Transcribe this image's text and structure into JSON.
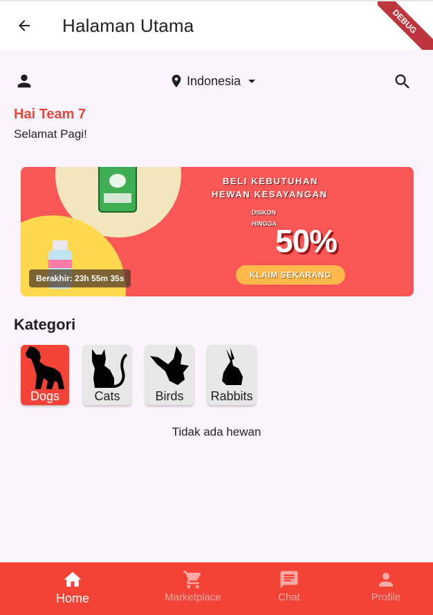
{
  "app_bar": {
    "title": "Halaman Utama"
  },
  "debug": {
    "label": "DEBUG"
  },
  "header": {
    "location": "Indonesia"
  },
  "greeting": {
    "title": "Hai Team 7",
    "subtitle": "Selamat Pagi!"
  },
  "banner": {
    "headline_1": "BELI KEBUTUHAN",
    "headline_2": "HEWAN KESAYANGAN",
    "discount_label": "DISKON HINGGA",
    "discount_value": "50%",
    "cta": "KLAIM SEKARANG",
    "timer": "Berakhir: 23h 55m 35s"
  },
  "categories": {
    "title": "Kategori",
    "items": [
      {
        "label": "Dogs",
        "selected": true
      },
      {
        "label": "Cats",
        "selected": false
      },
      {
        "label": "Birds",
        "selected": false
      },
      {
        "label": "Rabbits",
        "selected": false
      }
    ]
  },
  "empty_state": "Tidak ada hewan",
  "bottom_nav": {
    "items": [
      {
        "label": "Home",
        "icon": "home-icon",
        "active": true
      },
      {
        "label": "Marketplace",
        "icon": "cart-icon",
        "active": false
      },
      {
        "label": "Chat",
        "icon": "chat-icon",
        "active": false
      },
      {
        "label": "Profile",
        "icon": "person-icon",
        "active": false
      }
    ]
  },
  "colors": {
    "accent": "#f44336",
    "greeting": "#e8473c",
    "background": "#fcf4fd"
  }
}
